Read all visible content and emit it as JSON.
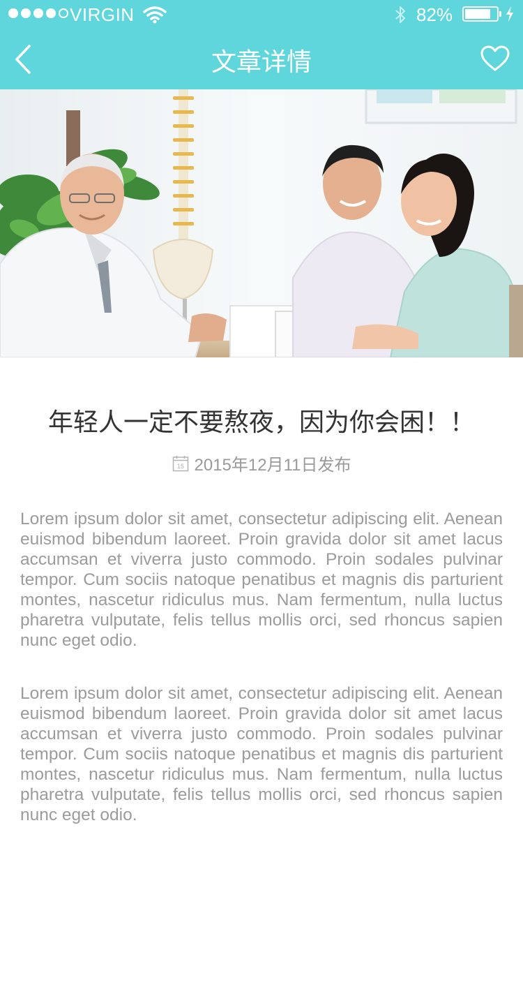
{
  "status_bar": {
    "carrier": "VIRGIN",
    "battery_percent_text": "82%",
    "battery_level": 0.82,
    "signal_dots": [
      true,
      true,
      true,
      true,
      false
    ]
  },
  "nav": {
    "title": "文章详情",
    "back_icon": "chevron-left-icon",
    "favorite_icon": "heart-outline-icon"
  },
  "colors": {
    "accent": "#5fd6db",
    "title_text": "#333333",
    "body_text": "#9b9b9b"
  },
  "article": {
    "title": "年轻人一定不要熬夜，因为你会困！！",
    "publish_date": "2015年12月11日发布",
    "date_icon": "calendar-icon",
    "paragraphs": [
      "Lorem ipsum dolor sit amet, consectetur adipiscing elit. Aenean euismod bibendum laoreet. Proin gravida dolor sit amet lacus accumsan et viverra justo commodo. Proin sodales pulvinar tempor. Cum sociis natoque penatibus et magnis dis parturient montes, nascetur ridiculus mus. Nam fermentum, nulla luctus pharetra vulputate, felis tellus mollis orci, sed rhoncus sapien nunc eget odio.",
      "Lorem ipsum dolor sit amet, consectetur adipiscing elit. Aenean euismod bibendum laoreet. Proin gravida dolor sit amet lacus accumsan et viverra justo commodo. Proin sodales pulvinar tempor. Cum sociis natoque penatibus et magnis dis parturient montes, nascetur ridiculus mus. Nam fermentum, nulla luctus pharetra vulputate, felis tellus mollis orci, sed rhoncus sapien nunc eget odio."
    ]
  }
}
